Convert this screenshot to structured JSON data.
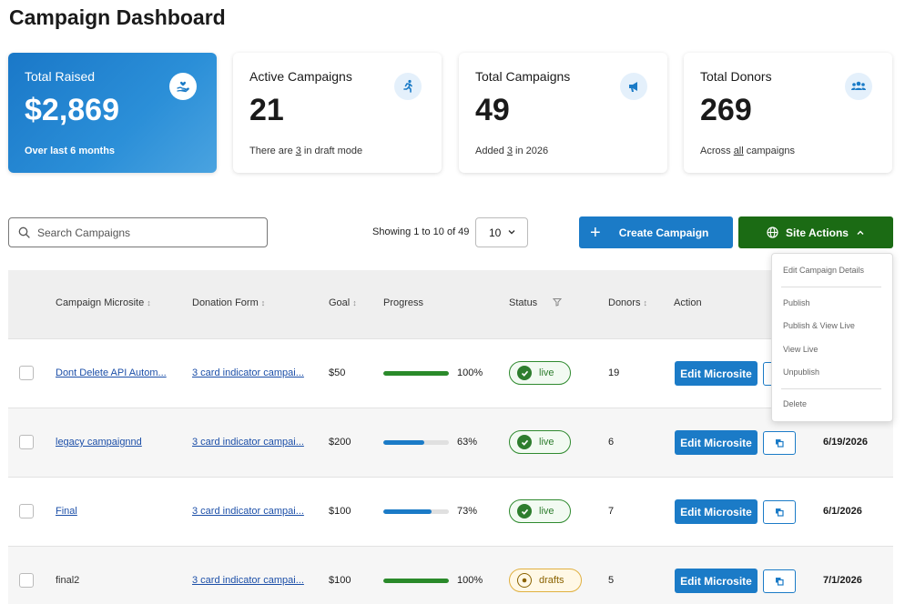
{
  "page": {
    "title": "Campaign Dashboard"
  },
  "cards": [
    {
      "label": "Total Raised",
      "value": "$2,869",
      "sub_pre": "Over last 6 months",
      "sub_u": "",
      "sub_post": "",
      "icon": "hand-heart-icon"
    },
    {
      "label": "Active Campaigns",
      "value": "21",
      "sub_pre": "There are ",
      "sub_u": "3",
      "sub_post": " in draft mode",
      "icon": "running-person-icon"
    },
    {
      "label": "Total Campaigns",
      "value": "49",
      "sub_pre": "Added ",
      "sub_u": "3",
      "sub_post": " in 2026",
      "icon": "megaphone-icon"
    },
    {
      "label": "Total Donors",
      "value": "269",
      "sub_pre": "Across ",
      "sub_u": "all",
      "sub_post": " campaigns",
      "icon": "people-icon"
    }
  ],
  "toolbar": {
    "search_placeholder": "Search Campaigns",
    "showing": "Showing 1 to 10 of 49",
    "page_size": "10",
    "create_label": "Create Campaign",
    "site_actions_label": "Site Actions"
  },
  "table": {
    "headers": {
      "microsite": "Campaign Microsite",
      "form": "Donation Form",
      "goal": "Goal",
      "progress": "Progress",
      "status": "Status",
      "donors": "Donors",
      "action": "Action"
    },
    "edit_label": "Edit Microsite",
    "rows": [
      {
        "name": "Dont Delete API Autom...",
        "name_link": true,
        "form": "3 card indicator campai...",
        "goal": "$50",
        "progress": 100,
        "pct": "100%",
        "status": "live",
        "donors": "19",
        "date": ""
      },
      {
        "name": "legacy campaignnd",
        "name_link": true,
        "form": "3 card indicator campai...",
        "goal": "$200",
        "progress": 63,
        "pct": "63%",
        "status": "live",
        "donors": "6",
        "date": "6/19/2026"
      },
      {
        "name": "Final",
        "name_link": true,
        "form": "3 card indicator campai...",
        "goal": "$100",
        "progress": 73,
        "pct": "73%",
        "status": "live",
        "donors": "7",
        "date": "6/1/2026"
      },
      {
        "name": "final2",
        "name_link": false,
        "form": "3 card indicator campai...",
        "goal": "$100",
        "progress": 100,
        "pct": "100%",
        "status": "drafts",
        "donors": "5",
        "date": "7/1/2026"
      }
    ]
  },
  "site_actions_menu": {
    "edit_details": "Edit Campaign Details",
    "publish": "Publish",
    "publish_view": "Publish & View Live",
    "view_live": "View Live",
    "unpublish": "Unpublish",
    "delete": "Delete"
  },
  "colors": {
    "primary": "#1b7bc7",
    "site_actions": "#1b6b14",
    "progress_complete": "#2a8a2a",
    "progress_partial": "#1b7bc7",
    "live": "#2e7d2e",
    "draft": "#8a6200"
  }
}
